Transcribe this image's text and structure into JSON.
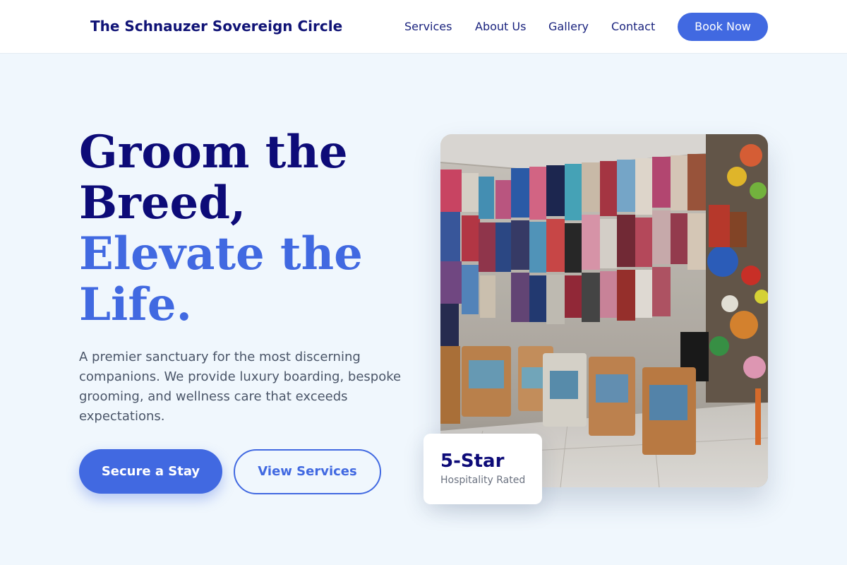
{
  "header": {
    "brand": "The Schnauzer Sovereign Circle",
    "nav": [
      "Services",
      "About Us",
      "Gallery",
      "Contact"
    ],
    "cta": "Book Now"
  },
  "hero": {
    "title_lines": [
      "Groom the",
      "Breed,"
    ],
    "accent_lines": [
      "Elevate the",
      "Life."
    ],
    "description": "A premier sanctuary for the most discerning companions. We provide luxury boarding, bespoke grooming, and wellness care that exceeds expectations.",
    "primary_button": "Secure a Stay",
    "secondary_button": "View Services"
  },
  "rating": {
    "value": "5-Star",
    "label": "Hospitality Rated"
  },
  "colors": {
    "brand_navy": "#101376",
    "accent_blue": "#4169e1",
    "background": "#f0f7fd"
  }
}
